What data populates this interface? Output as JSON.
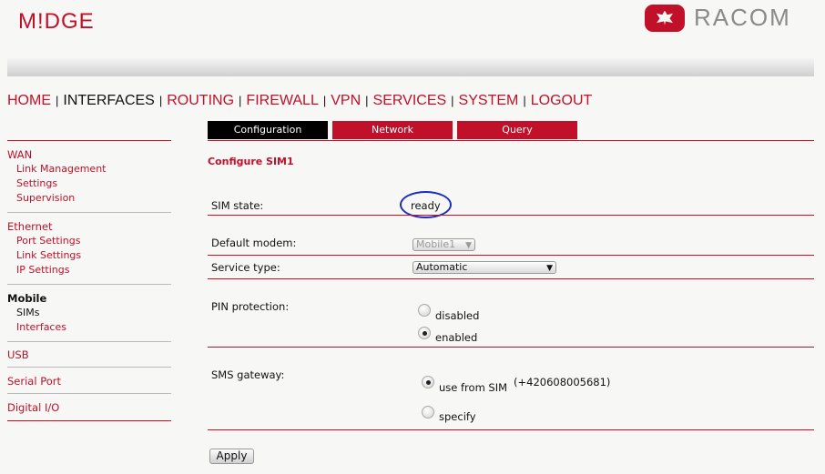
{
  "header": {
    "left_logo": "M!DGE",
    "right_logo": "RACOM"
  },
  "top_nav": [
    {
      "label": "HOME",
      "current": false
    },
    {
      "label": "INTERFACES",
      "current": true
    },
    {
      "label": "ROUTING",
      "current": false
    },
    {
      "label": "FIREWALL",
      "current": false
    },
    {
      "label": "VPN",
      "current": false
    },
    {
      "label": "SERVICES",
      "current": false
    },
    {
      "label": "SYSTEM",
      "current": false
    },
    {
      "label": "LOGOUT",
      "current": false
    }
  ],
  "sidebar": {
    "wan": {
      "heading": "WAN",
      "items": [
        "Link Management",
        "Settings",
        "Supervision"
      ]
    },
    "ethernet": {
      "heading": "Ethernet",
      "items": [
        "Port Settings",
        "Link Settings",
        "IP Settings"
      ]
    },
    "mobile": {
      "heading": "Mobile",
      "items": [
        "SIMs",
        "Interfaces"
      ]
    },
    "usb": "USB",
    "serial": "Serial Port",
    "digital": "Digital I/O"
  },
  "tabs": [
    "Configuration",
    "Network",
    "Query"
  ],
  "section_title": "Configure SIM1",
  "form": {
    "sim_state_label": "SIM state:",
    "sim_state_value": "ready",
    "default_modem_label": "Default modem:",
    "default_modem_value": "Mobile1",
    "service_type_label": "Service type:",
    "service_type_value": "Automatic",
    "pin_label": "PIN protection:",
    "pin_options": [
      "disabled",
      "enabled"
    ],
    "pin_selected": "enabled",
    "sms_label": "SMS gateway:",
    "sms_options": [
      "use from SIM",
      "specify"
    ],
    "sms_selected": "use from SIM",
    "sms_number": "(+420608005681)",
    "apply_label": "Apply"
  },
  "colors": {
    "accent": "#c0102a",
    "highlight_oval": "#1a2fc2"
  }
}
